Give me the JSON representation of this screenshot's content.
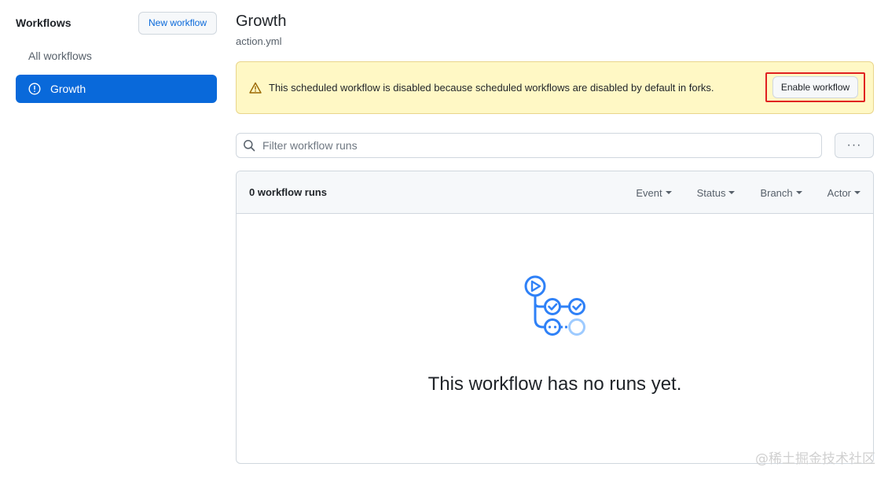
{
  "sidebar": {
    "title": "Workflows",
    "new_workflow_label": "New workflow",
    "items": [
      {
        "label": "All workflows",
        "active": false
      },
      {
        "label": "Growth",
        "active": true,
        "icon": "alert-circle-icon"
      }
    ]
  },
  "main": {
    "title": "Growth",
    "file": "action.yml",
    "flash": {
      "message": "This scheduled workflow is disabled because scheduled workflows are disabled by default in forks.",
      "icon": "warning-icon",
      "button_label": "Enable workflow"
    },
    "filter": {
      "placeholder": "Filter workflow runs",
      "more_label": "···"
    },
    "runs": {
      "count_label": "0 workflow runs",
      "filters": [
        "Event",
        "Status",
        "Branch",
        "Actor"
      ],
      "empty_message": "This workflow has no runs yet."
    }
  },
  "watermark": "@稀土掘金技术社区",
  "colors": {
    "accent": "#0969da",
    "flash_bg": "#fff8c5",
    "highlight_border": "#e02020"
  }
}
